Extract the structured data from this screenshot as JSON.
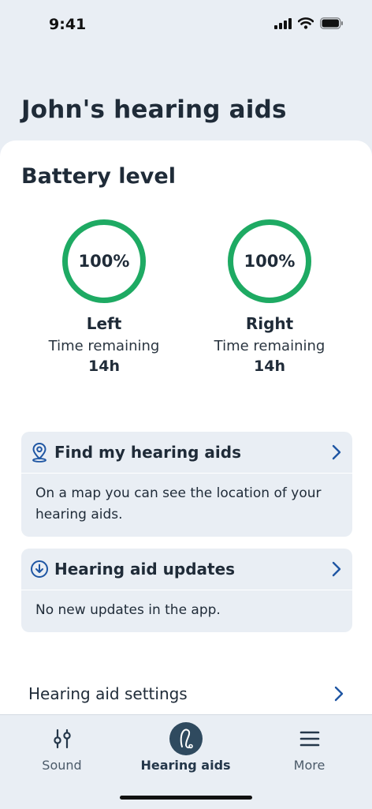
{
  "status_bar": {
    "time": "9:41"
  },
  "page_title": "John's hearing aids",
  "battery": {
    "title": "Battery level",
    "left": {
      "percent": "100%",
      "side": "Left",
      "remaining_label": "Time remaining",
      "remaining_value": "14h"
    },
    "right": {
      "percent": "100%",
      "side": "Right",
      "remaining_label": "Time remaining",
      "remaining_value": "14h"
    }
  },
  "find_card": {
    "title": "Find my hearing aids",
    "body": "On a map you can see the location of your hearing aids.",
    "icon": "location-pin-icon"
  },
  "updates_card": {
    "title": "Hearing aid updates",
    "body": "No new updates in the app.",
    "icon": "download-icon"
  },
  "settings_row": {
    "label": "Hearing aid settings"
  },
  "tabs": [
    {
      "label": "Sound",
      "icon": "sliders-icon"
    },
    {
      "label": "Hearing aids",
      "icon": "hearing-aid-icon",
      "active": true
    },
    {
      "label": "More",
      "icon": "menu-icon"
    }
  ],
  "colors": {
    "accent": "#1eaa63",
    "primary": "#24374a",
    "link": "#1f56a3",
    "background": "#e9eef4"
  }
}
